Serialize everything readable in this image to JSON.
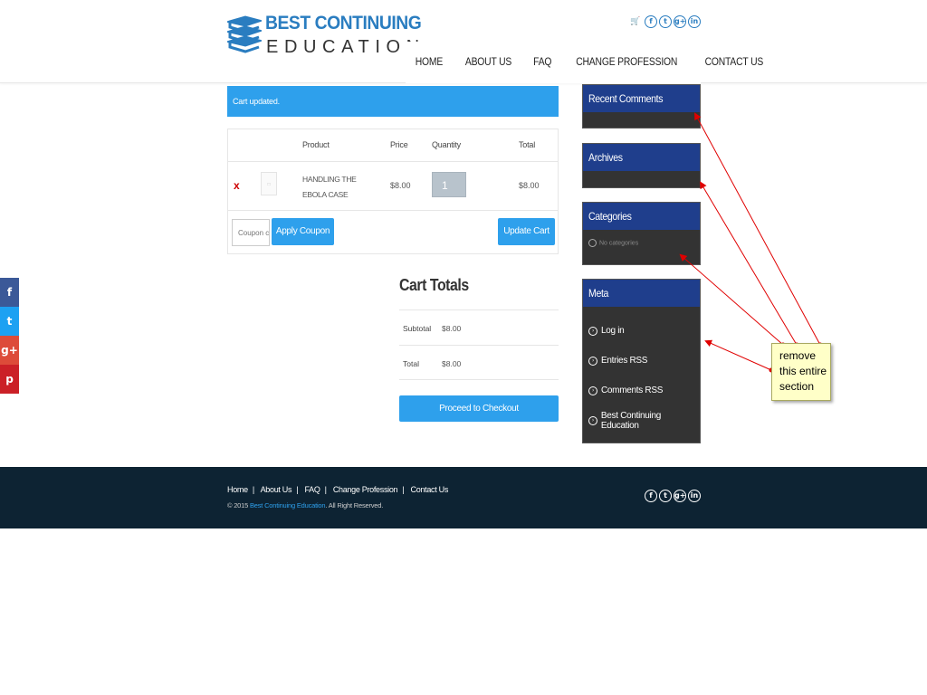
{
  "brand": {
    "line1": "BEST CONTINUING",
    "line2": "EDUCATION"
  },
  "header": {
    "cart_icon": "cart-icon",
    "social": [
      {
        "name": "facebook",
        "glyph": "f"
      },
      {
        "name": "twitter",
        "glyph": "t"
      },
      {
        "name": "google-plus",
        "glyph": "g+"
      },
      {
        "name": "linkedin",
        "glyph": "in"
      }
    ]
  },
  "nav": [
    "HOME",
    "ABOUT US",
    "FAQ",
    "CHANGE PROFESSION",
    "CONTACT US"
  ],
  "notice": "Cart updated.",
  "cart": {
    "headers": {
      "product": "Product",
      "price": "Price",
      "quantity": "Quantity",
      "total": "Total"
    },
    "item": {
      "remove": "x",
      "name": "HANDLING THE EBOLA CASE",
      "price": "$8.00",
      "quantity": "1",
      "total": "$8.00"
    },
    "coupon_placeholder": "Coupon code",
    "apply_label": "Apply Coupon",
    "update_label": "Update Cart"
  },
  "totals": {
    "title": "Cart Totals",
    "rows": [
      {
        "label": "Subtotal",
        "value": "$8.00"
      },
      {
        "label": "Total",
        "value": "$8.00"
      }
    ],
    "checkout_label": "Proceed to Checkout"
  },
  "sidebar": {
    "recent_comments": "Recent Comments",
    "archives": "Archives",
    "categories": {
      "title": "Categories",
      "empty": "No categories"
    },
    "meta": {
      "title": "Meta",
      "items": [
        "Log in",
        "Entries RSS",
        "Comments RSS",
        "Best Continuing Education"
      ]
    }
  },
  "annotation": {
    "lines": [
      "remove",
      "this entire",
      "section"
    ]
  },
  "share_bar": [
    {
      "name": "facebook",
      "glyph": "f",
      "color": "#3b5998"
    },
    {
      "name": "twitter",
      "glyph": "t",
      "color": "#1da1f2"
    },
    {
      "name": "google-plus",
      "glyph": "g+",
      "color": "#dd4b39"
    },
    {
      "name": "pinterest",
      "glyph": "p",
      "color": "#cb2027"
    }
  ],
  "footer": {
    "links": [
      "Home",
      "About Us",
      "FAQ",
      "Change Profession",
      "Contact Us"
    ],
    "copyright_prefix": "© 2015 ",
    "copyright_link": "Best Continuing Education",
    "copyright_suffix": ". All Right Reserved."
  },
  "colors": {
    "accent": "#2ea0ec",
    "widget_title": "#1f3e8c",
    "widget_body": "#333333",
    "footer": "#0d2333",
    "annotation_arrow": "#e00000"
  }
}
